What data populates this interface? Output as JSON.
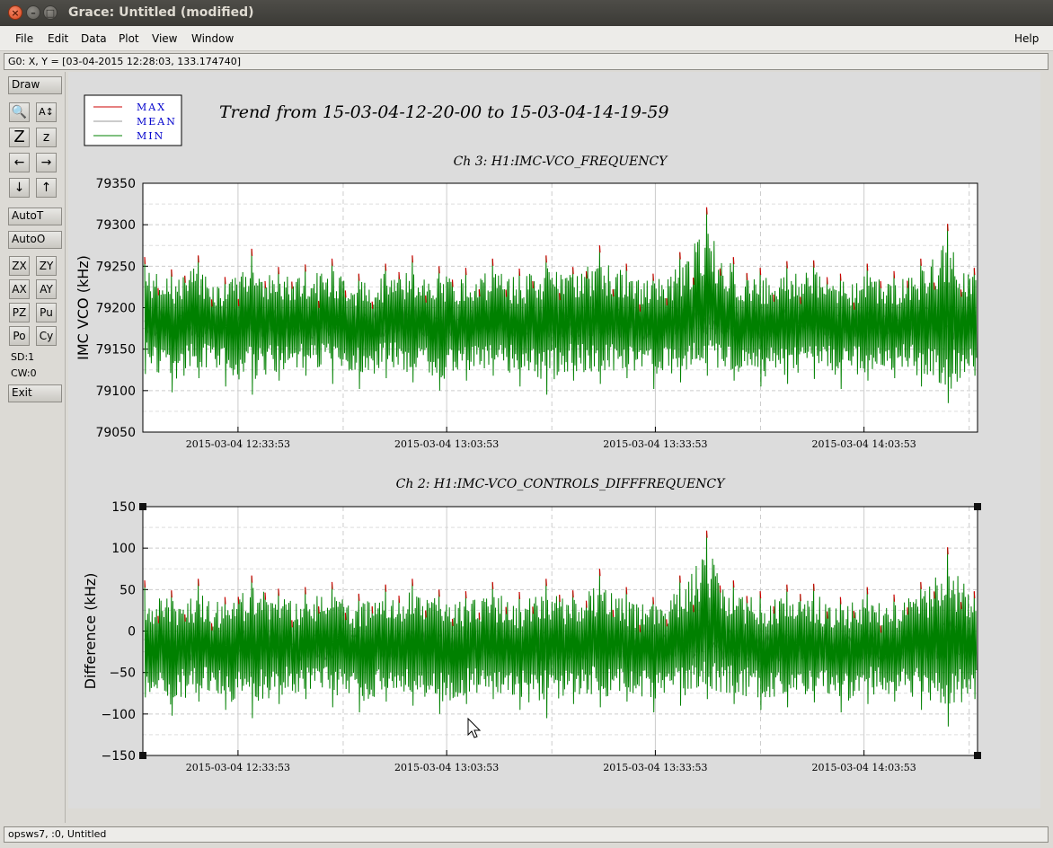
{
  "window": {
    "title": "Grace: Untitled (modified)",
    "close_glyph": "×",
    "min_glyph": "–",
    "max_glyph": "□"
  },
  "menu": {
    "file": "File",
    "edit": "Edit",
    "data": "Data",
    "plot": "Plot",
    "view": "View",
    "window": "Window",
    "help": "Help"
  },
  "coord_readout": "G0: X, Y = [03-04-2015 12:28:03, 133.174740]",
  "toolbar": {
    "draw": "Draw",
    "zoom_glyph": "🔍",
    "autoscale_text_glyph": "A↕",
    "zoom_in_glyph": "Z",
    "zoom_out_glyph": "z",
    "left_glyph": "←",
    "right_glyph": "→",
    "down_glyph": "↓",
    "up_glyph": "↑",
    "autot": "AutoT",
    "autoo": "AutoO",
    "zx": "ZX",
    "zy": "ZY",
    "ax": "AX",
    "ay": "AY",
    "pz": "PZ",
    "pu": "Pu",
    "po": "Po",
    "cy": "Cy",
    "sd": "SD:1",
    "cw": "CW:0",
    "exit": "Exit"
  },
  "status": "opsws7, :0, Untitled",
  "colors": {
    "max": "#cc0000",
    "mean": "#999999",
    "min": "#008000",
    "legend_text": "#0000cc"
  },
  "chart_data": [
    {
      "type": "line",
      "title": "Trend from 15-03-04-12-20-00 to 15-03-04-14-19-59",
      "subtitle": "Ch 3: H1:IMC-VCO_FREQUENCY",
      "xlabel": "",
      "ylabel": "IMC VCO (kHz)",
      "ylim": [
        79050,
        79350
      ],
      "yticks": [
        79050,
        79100,
        79150,
        79200,
        79250,
        79300,
        79350
      ],
      "xticks": [
        "2015-03-04 12:33:53",
        "2015-03-04 13:03:53",
        "2015-03-04 13:33:53",
        "2015-03-04 14:03:53"
      ],
      "grid": true,
      "legend": "top-left",
      "series": [
        {
          "name": "MAX",
          "values": [
            79260,
            79245,
            79262,
            79236,
            79270,
            79248,
            79251,
            79258,
            79240,
            79252,
            79262,
            79249,
            79247,
            79258,
            79246,
            79262,
            79248,
            79274,
            79252,
            79240,
            79266,
            79320,
            79260,
            79247,
            79255,
            79256,
            79240,
            79252,
            79243,
            79258,
            79300,
            79247
          ]
        },
        {
          "name": "MEAN",
          "values": [
            79185,
            79180,
            79182,
            79178,
            79186,
            79181,
            79180,
            79183,
            79179,
            79182,
            79184,
            79180,
            79181,
            79183,
            79179,
            79184,
            79182,
            79186,
            79180,
            79178,
            79184,
            79192,
            79183,
            79180,
            79182,
            79181,
            79179,
            79182,
            79180,
            79183,
            79188,
            79180
          ]
        },
        {
          "name": "MIN",
          "values": [
            79120,
            79098,
            79115,
            79105,
            79095,
            79112,
            79118,
            79108,
            79102,
            79115,
            79110,
            79100,
            79112,
            79118,
            79105,
            79095,
            79112,
            79108,
            79115,
            79102,
            79110,
            79118,
            79112,
            79105,
            79108,
            79114,
            79102,
            79112,
            79115,
            79105,
            79085,
            79118
          ]
        }
      ]
    },
    {
      "type": "line",
      "subtitle": "Ch 2: H1:IMC-VCO_CONTROLS_DIFFFREQUENCY",
      "xlabel": "",
      "ylabel": "Difference (kHz)",
      "ylim": [
        -150,
        150
      ],
      "yticks": [
        -150,
        -100,
        -50,
        0,
        50,
        100,
        150
      ],
      "xticks": [
        "2015-03-04 12:33:53",
        "2015-03-04 13:03:53",
        "2015-03-04 13:33:53",
        "2015-03-04 14:03:53"
      ],
      "grid": true,
      "series": [
        {
          "name": "MAX",
          "values": [
            60,
            48,
            62,
            40,
            66,
            50,
            52,
            58,
            44,
            55,
            62,
            49,
            47,
            58,
            46,
            62,
            48,
            74,
            52,
            40,
            66,
            120,
            60,
            47,
            55,
            56,
            40,
            52,
            43,
            58,
            100,
            47
          ]
        },
        {
          "name": "MEAN",
          "values": [
            -15,
            -20,
            -18,
            -22,
            -14,
            -19,
            -20,
            -17,
            -21,
            -18,
            -16,
            -20,
            -19,
            -17,
            -21,
            -16,
            -18,
            -14,
            -20,
            -22,
            -16,
            -8,
            -17,
            -20,
            -18,
            -19,
            -21,
            -18,
            -20,
            -17,
            -12,
            -20
          ]
        },
        {
          "name": "MIN",
          "values": [
            -80,
            -102,
            -85,
            -95,
            -105,
            -88,
            -82,
            -92,
            -98,
            -85,
            -90,
            -100,
            -88,
            -82,
            -95,
            -105,
            -88,
            -92,
            -85,
            -98,
            -90,
            -82,
            -88,
            -95,
            -92,
            -86,
            -98,
            -88,
            -85,
            -95,
            -115,
            -82
          ]
        }
      ]
    }
  ]
}
